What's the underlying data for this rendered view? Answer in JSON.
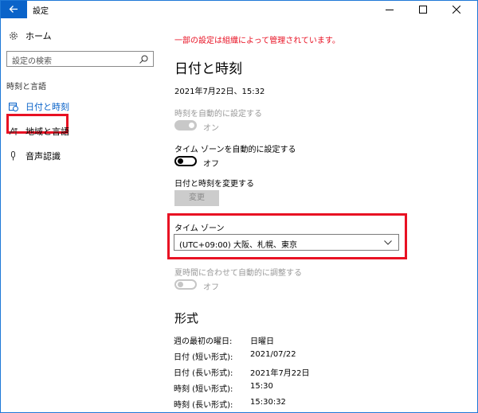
{
  "window": {
    "title": "設定"
  },
  "sidebar": {
    "home_label": "ホーム",
    "search_placeholder": "設定の検索",
    "section_header": "時刻と言語",
    "items": [
      {
        "label": "日付と時刻",
        "icon": "calendar-clock-icon",
        "selected": true
      },
      {
        "label": "地域と言語",
        "icon": "region-language-icon",
        "selected": false
      },
      {
        "label": "音声認識",
        "icon": "microphone-icon",
        "selected": false
      }
    ]
  },
  "main": {
    "managed_notice": "一部の設定は組織によって管理されています。",
    "heading": "日付と時刻",
    "current_datetime": "2021年7月22日、15:32",
    "auto_time": {
      "label": "時刻を自動的に設定する",
      "state": "オン",
      "enabled": false
    },
    "auto_timezone": {
      "label": "タイム ゾーンを自動的に設定する",
      "state": "オフ"
    },
    "change_datetime": {
      "label": "日付と時刻を変更する",
      "button": "変更"
    },
    "timezone": {
      "label": "タイム ゾーン",
      "value": "(UTC+09:00) 大阪、札幌、東京"
    },
    "dst": {
      "label": "夏時間に合わせて自動的に調整する",
      "state": "オフ",
      "enabled": false
    },
    "format_heading": "形式",
    "formats": [
      {
        "label": "週の最初の曜日:",
        "value": "日曜日"
      },
      {
        "label": "日付 (短い形式):",
        "value": "2021/07/22"
      },
      {
        "label": "日付 (長い形式):",
        "value": "2021年7月22日"
      },
      {
        "label": "時刻 (短い形式):",
        "value": "15:30"
      },
      {
        "label": "時刻 (長い形式):",
        "value": "15:30:32"
      }
    ]
  },
  "colors": {
    "accent": "#0a63c9",
    "highlight_box": "#e81123",
    "notice": "#e81123"
  }
}
